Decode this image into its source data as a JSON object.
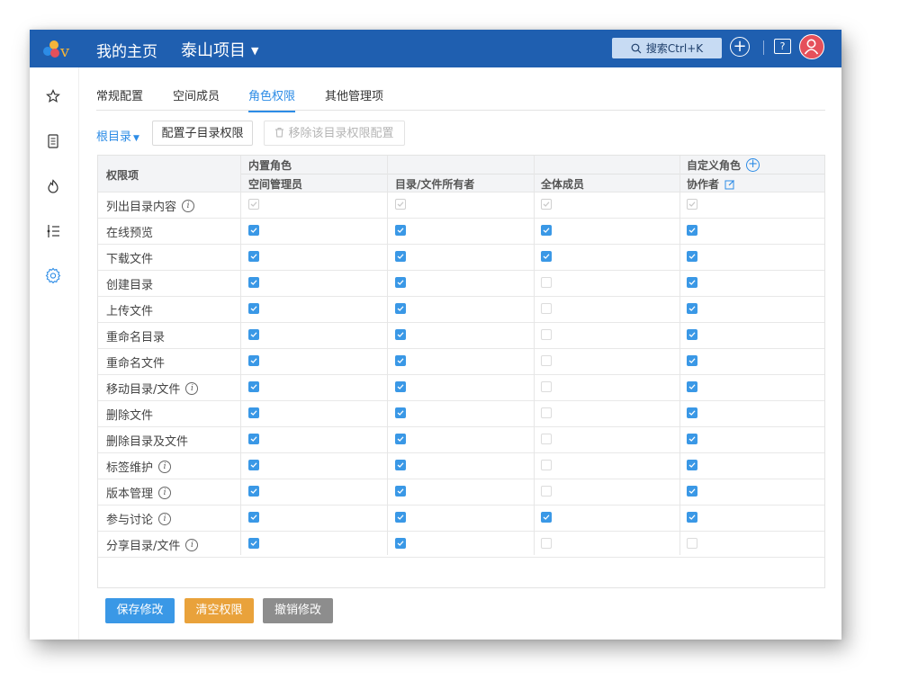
{
  "header": {
    "logo_letter": "v",
    "home": "我的主页",
    "project": "泰山项目",
    "search_label": "搜索Ctrl+K",
    "help_glyph": "?"
  },
  "sidebar": {
    "icons": [
      "star-icon",
      "document-icon",
      "fire-icon",
      "list-icon",
      "settings-icon"
    ],
    "active": "settings-icon"
  },
  "tabs": [
    {
      "label": "常规配置",
      "active": false
    },
    {
      "label": "空间成员",
      "active": false
    },
    {
      "label": "角色权限",
      "active": true
    },
    {
      "label": "其他管理项",
      "active": false
    }
  ],
  "toolbar": {
    "root_dir": "根目录",
    "config_sub": "配置子目录权限",
    "remove_config": "移除该目录权限配置"
  },
  "table": {
    "permission_header": "权限项",
    "builtin_group": "内置角色",
    "custom_group": "自定义角色",
    "columns": [
      "空间管理员",
      "目录/文件所有者",
      "全体成员",
      "协作者"
    ],
    "rows": [
      {
        "label": "列出目录内容",
        "info": true,
        "values": [
          "disabled",
          "disabled",
          "disabled",
          "disabled"
        ]
      },
      {
        "label": "在线预览",
        "info": false,
        "values": [
          "on",
          "on",
          "on",
          "on"
        ]
      },
      {
        "label": "下载文件",
        "info": false,
        "values": [
          "on",
          "on",
          "on",
          "on"
        ]
      },
      {
        "label": "创建目录",
        "info": false,
        "values": [
          "on",
          "on",
          "off",
          "on"
        ]
      },
      {
        "label": "上传文件",
        "info": false,
        "values": [
          "on",
          "on",
          "off",
          "on"
        ]
      },
      {
        "label": "重命名目录",
        "info": false,
        "values": [
          "on",
          "on",
          "off",
          "on"
        ]
      },
      {
        "label": "重命名文件",
        "info": false,
        "values": [
          "on",
          "on",
          "off",
          "on"
        ]
      },
      {
        "label": "移动目录/文件",
        "info": true,
        "values": [
          "on",
          "on",
          "off",
          "on"
        ]
      },
      {
        "label": "删除文件",
        "info": false,
        "values": [
          "on",
          "on",
          "off",
          "on"
        ]
      },
      {
        "label": "删除目录及文件",
        "info": false,
        "values": [
          "on",
          "on",
          "off",
          "on"
        ]
      },
      {
        "label": "标签维护",
        "info": true,
        "values": [
          "on",
          "on",
          "off",
          "on"
        ]
      },
      {
        "label": "版本管理",
        "info": true,
        "values": [
          "on",
          "on",
          "off",
          "on"
        ]
      },
      {
        "label": "参与讨论",
        "info": true,
        "values": [
          "on",
          "on",
          "on",
          "on"
        ]
      },
      {
        "label": "分享目录/文件",
        "info": true,
        "values": [
          "on",
          "on",
          "off",
          "off"
        ]
      }
    ]
  },
  "footer": {
    "save": "保存修改",
    "clear": "清空权限",
    "revert": "撤销修改"
  },
  "colors": {
    "brand": "#1f5fb0",
    "accent": "#2d8ce6",
    "save_button": "#3a98e6",
    "clear_button": "#e9a23b",
    "revert_button": "#8d8d8d"
  }
}
